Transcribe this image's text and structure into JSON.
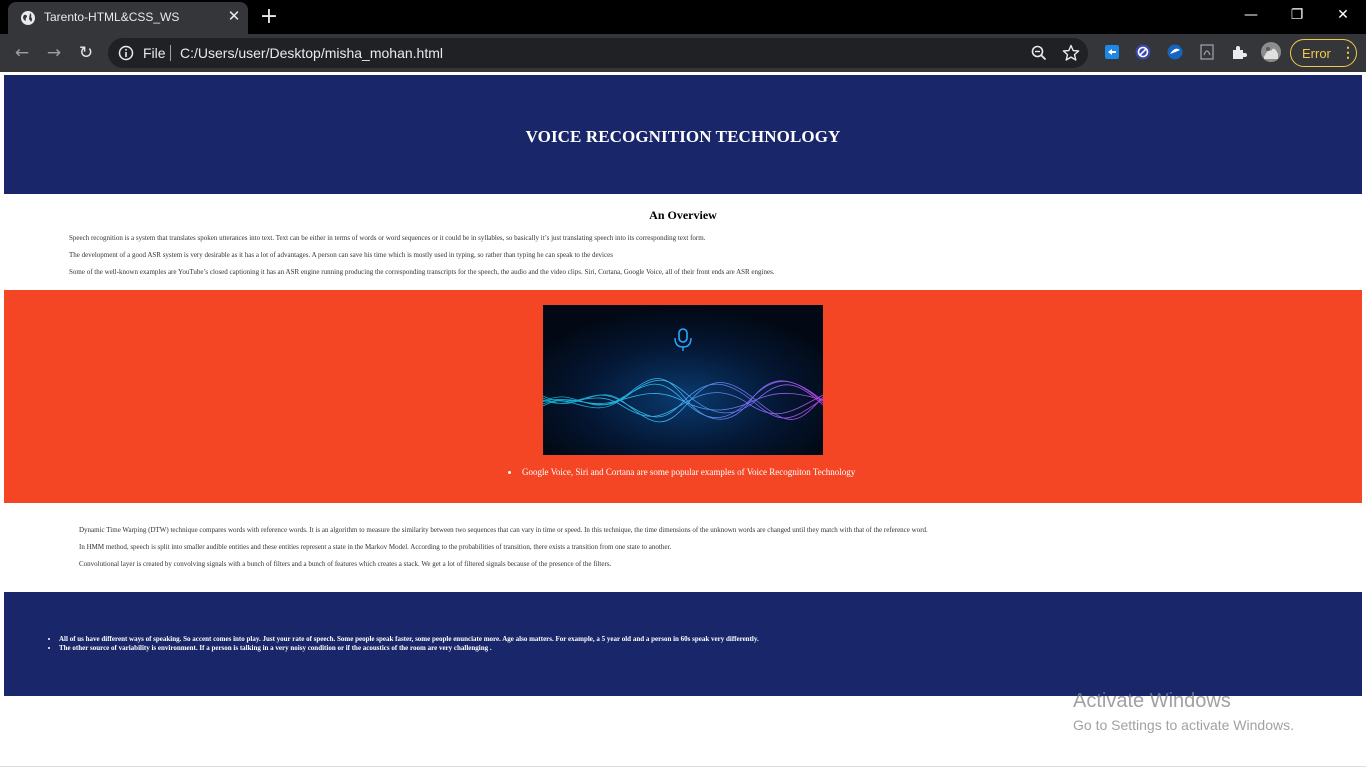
{
  "browser": {
    "tab": {
      "title": "Tarento-HTML&CSS_WS",
      "close": "✕"
    },
    "new_tab": "+",
    "window_controls": {
      "minimize": "—",
      "restore": "❐",
      "close": "✕"
    },
    "nav": {
      "back": "←",
      "forward": "→",
      "reload": "↻"
    },
    "address": {
      "scheme": "File",
      "url": "C:/Users/user/Desktop/misha_mohan.html"
    },
    "profile_status": {
      "label": "Error",
      "menu": "⋮"
    },
    "icons": [
      "page-info-icon",
      "zoom-icon",
      "bookmark-star-icon",
      "extension-icons",
      "puzzle-icon",
      "avatar"
    ]
  },
  "page": {
    "hero_title": "VOICE RECOGNITION TECHNOLOGY",
    "overview": {
      "title": "An Overview",
      "paragraphs": [
        "Speech recognition is a system that translates spoken utterances into text. Text can be either in terms of words or word sequences or it could be in syllables, so basically it’s just translating speech into its corresponding text form.",
        "The development of a good ASR system is very desirable as it has a lot of advantages. A person can save his time which is mostly used in typing, so rather than typing he can speak to the devices",
        "Some of the well-known examples are YouTube’s closed captioning it has an ASR engine running producing the corresponding transcripts for the speech, the audio and the video clips. Siri, Cortana, Google Voice, all of their front ends are ASR engines."
      ]
    },
    "showcase": {
      "image": "voice-wave-image",
      "bullet": "Google Voice, Siri and Cortana are some popular examples of Voice Recogniton Technology"
    },
    "methods": [
      "Dynamic Time Warping (DTW) technique compares words with reference words. It is an algorithm to measure the similarity between two sequences that can vary in time or speed. In this technique, the time dimensions of the unknown words are changed until they match with that of the reference word.",
      "In HMM method, speech is split into smaller audible entities and these entities represent a state in the Markov Model. According to the probabilities of transition, there exists a transition from one state to another.",
      "Convolutional layer is created by convolving signals with a bunch of filters and a bunch of features which creates a stack. We get a lot of filtered signals because of the presence of the filters."
    ],
    "footer_items": [
      "All of us have different ways of speaking. So accent comes into play. Just your rate of speech. Some people speak faster, some people enunciate more. Age also matters. For example, a 5 year old and a person in 60s speak very differently.",
      "The other source of variability is environment. If a person is talking in a very noisy condition or if the acoustics of the room are very challenging ."
    ]
  },
  "os_watermark": {
    "title": "Activate Windows",
    "subtitle": "Go to Settings to activate Windows."
  },
  "colors": {
    "hero_bg": "#19276a",
    "showcase_bg": "#f44525",
    "chrome_dark": "#35363a",
    "error_accent": "#f2c94c"
  }
}
